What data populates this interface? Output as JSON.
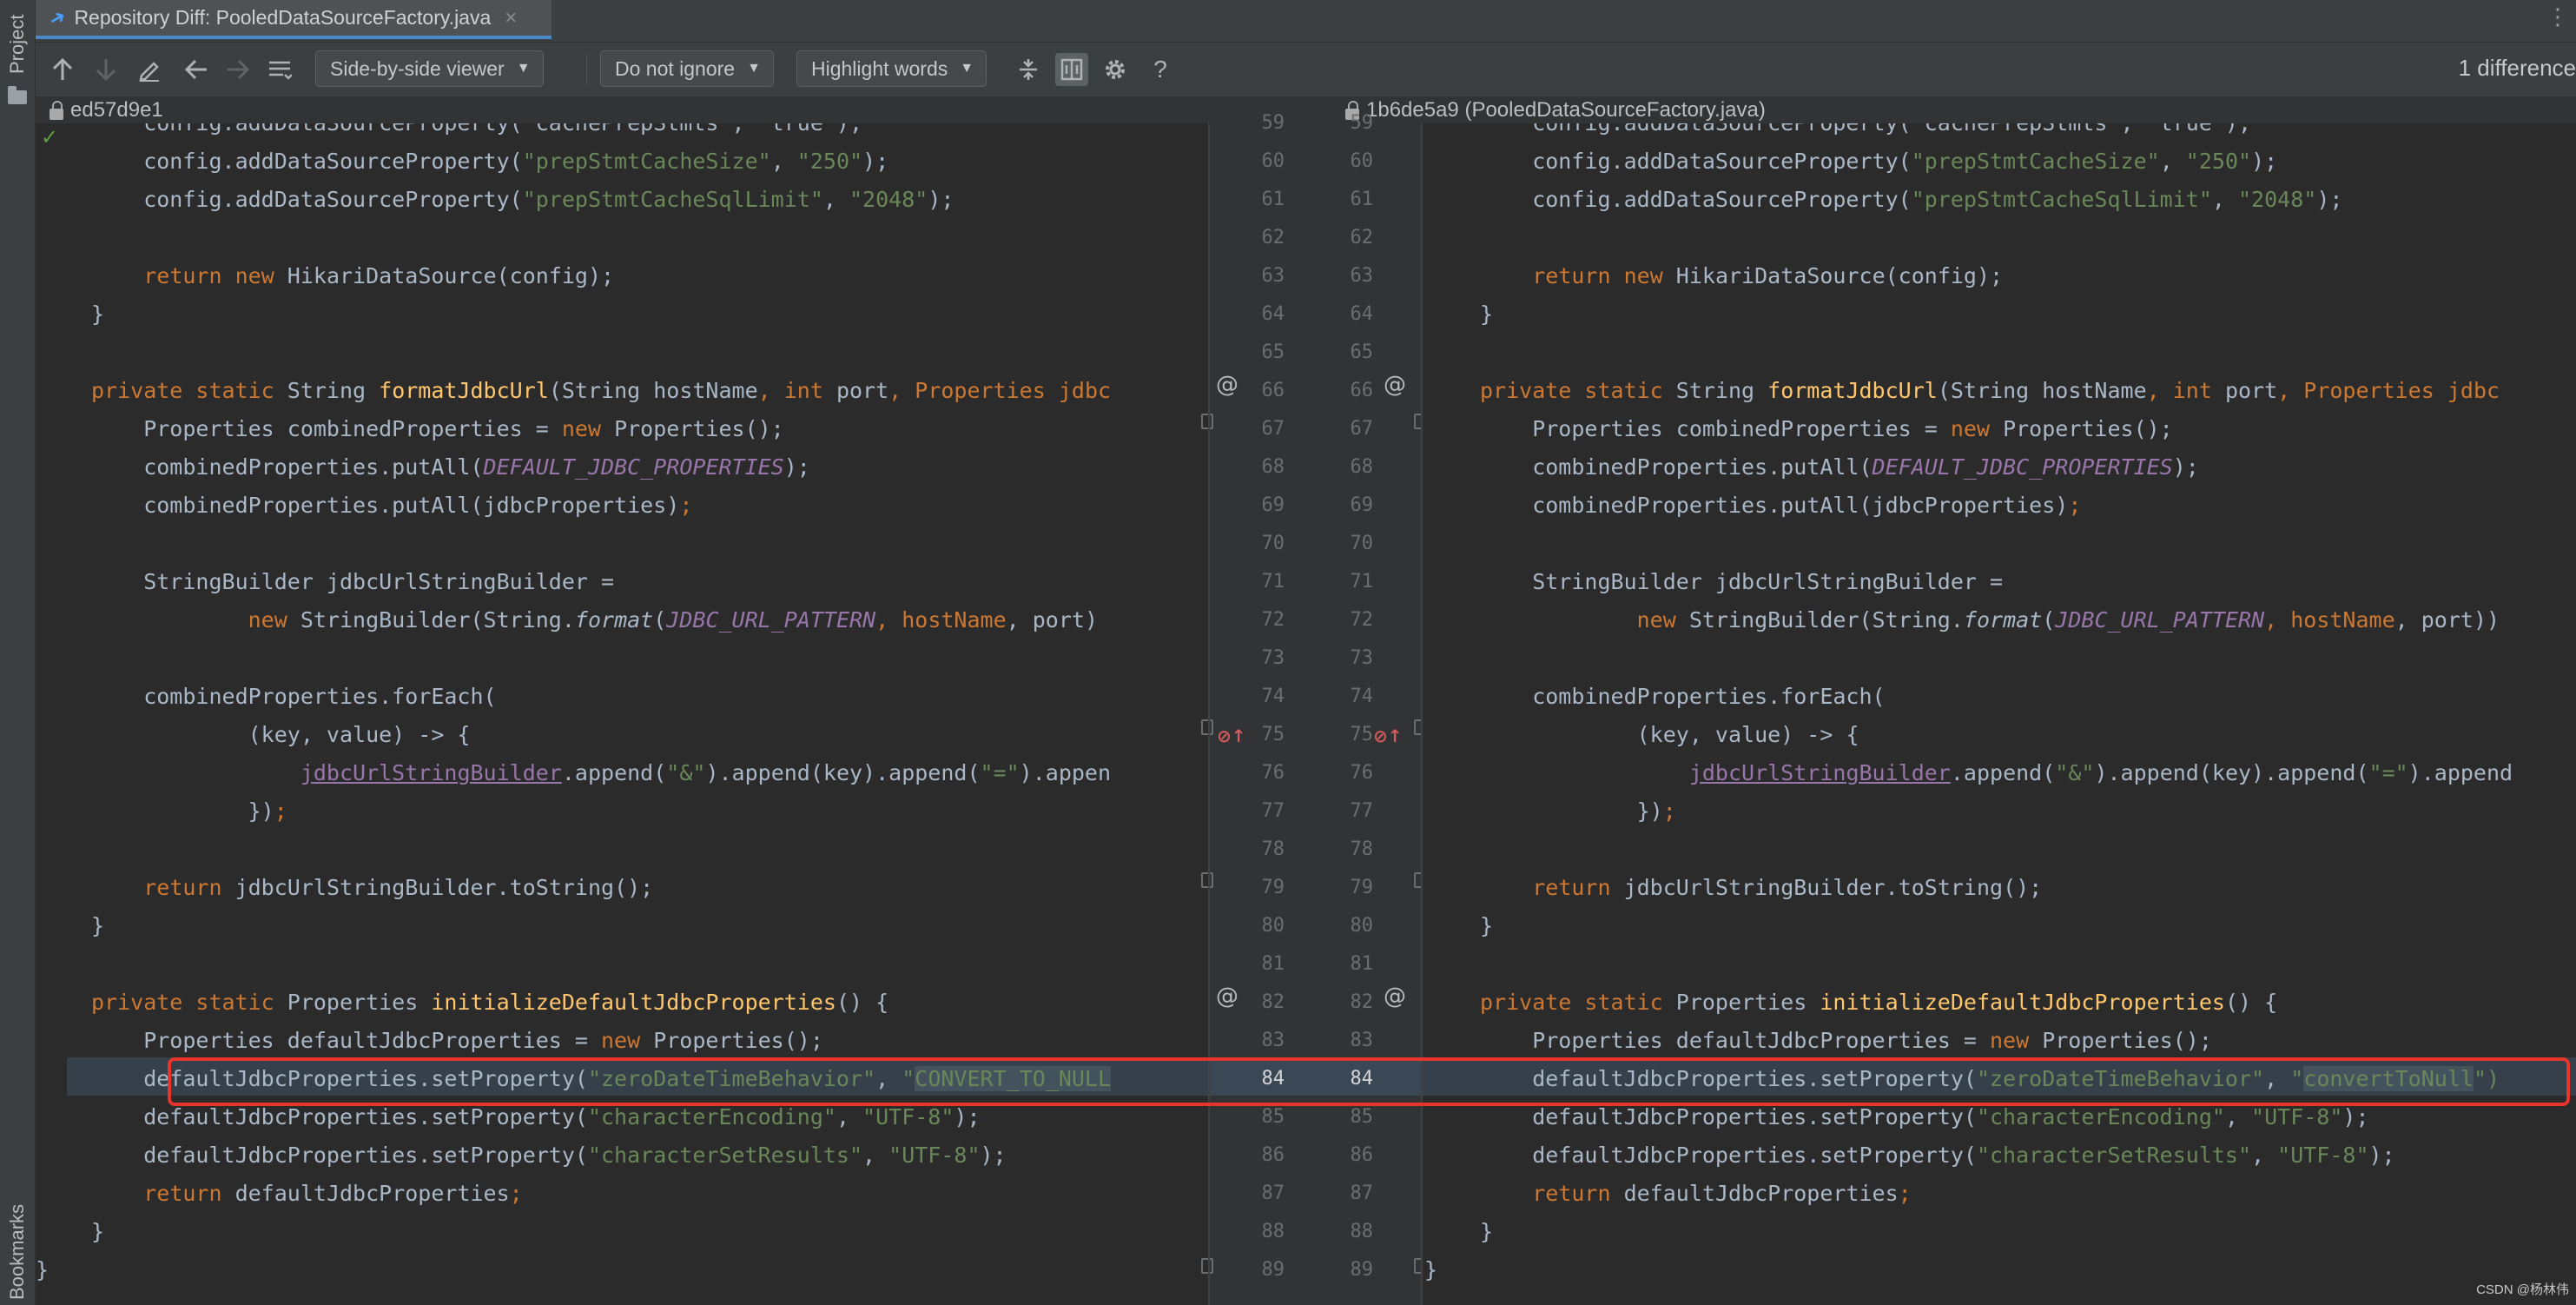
{
  "side_strip": {
    "project_label": "Project",
    "bookmarks_label": "Bookmarks"
  },
  "tab": {
    "title": "Repository Diff: PooledDataSourceFactory.java",
    "close": "×",
    "more": "⋮"
  },
  "toolbar": {
    "viewer_mode": "Side-by-side viewer",
    "ignore_mode": "Do not ignore",
    "highlight_mode": "Highlight words",
    "help": "?",
    "difference_count": "1 difference"
  },
  "left_revision": "ed57d9e1",
  "right_revision": "1b6de5a9 (PooledDataSourceFactory.java)",
  "line_numbers": {
    "first_partial": "59",
    "lines": [
      "60",
      "61",
      "62",
      "63",
      "64",
      "65",
      "66",
      "67",
      "68",
      "69",
      "70",
      "71",
      "72",
      "73",
      "74",
      "75",
      "76",
      "77",
      "78",
      "79",
      "80",
      "81",
      "82",
      "83",
      "84",
      "85",
      "86",
      "87",
      "88",
      "89"
    ],
    "changed_line": "84"
  },
  "left_code": {
    "line59": "    config.addDataSourceProperty(\"cachePrepStmts\", \"true\");",
    "line60_a": "    config.addDataSourceProperty(",
    "line60_s1": "\"prepStmtCacheSize\"",
    "line60_b": ", ",
    "line60_s2": "\"250\"",
    "line60_c": ");",
    "line61_a": "    config.addDataSourceProperty(",
    "line61_s1": "\"prepStmtCacheSqlLimit\"",
    "line61_b": ", ",
    "line61_s2": "\"2048\"",
    "line61_c": ");",
    "line63_a": "    ",
    "line63_kw1": "return",
    "line63_sp": " ",
    "line63_kw2": "new",
    "line63_b": " HikariDataSource(config);",
    "line64": "}",
    "line66_kw": "private static",
    "line66_a": " String ",
    "line66_fn": "formatJdbcUrl",
    "line66_b": "(String hostName",
    "line66_c": ", ",
    "line66_kw2": "int",
    "line66_d": " port",
    "line66_e": ", Properties jdbc",
    "line67_a": "    Properties combinedProperties = ",
    "line67_kw": "new",
    "line67_b": " Properties();",
    "line68_a": "    combinedProperties.putAll(",
    "line68_const": "DEFAULT_JDBC_PROPERTIES",
    "line68_b": ");",
    "line69_a": "    combinedProperties.putAll(jdbcProperties)",
    "line69_b": ";",
    "line71": "    StringBuilder jdbcUrlStringBuilder =",
    "line72_a": "            ",
    "line72_kw": "new",
    "line72_b": " StringBuilder(String.",
    "line72_static": "format",
    "line72_c": "(",
    "line72_const": "JDBC_URL_PATTERN",
    "line72_d": ", hostName",
    "line72_e": ", port)",
    "line74": "    combinedProperties.forEach(",
    "line75_a": "            (key",
    "line75_b": ", value) -> {",
    "line76_a": "                ",
    "line76_field": "jdbcUrlStringBuilder",
    "line76_b": ".append(",
    "line76_s1": "\"&\"",
    "line76_c": ").append(key).append(",
    "line76_s2": "\"=\"",
    "line76_d": ").appen",
    "line77_a": "            })",
    "line77_b": ";",
    "line79_a": "    ",
    "line79_kw": "return",
    "line79_b": " jdbcUrlStringBuilder.toString();",
    "line80": "}",
    "line82_kw": "private static",
    "line82_a": " Properties ",
    "line82_fn": "initializeDefaultJdbcProperties",
    "line82_b": "() {",
    "line83_a": "    Properties defaultJdbcProperties = ",
    "line83_kw": "new",
    "line83_b": " Properties();",
    "line84_a": "    defaultJdbcProperties.setProperty(",
    "line84_s1": "\"zeroDateTimeBehavior\"",
    "line84_b": ", ",
    "line84_s2a": "\"",
    "line84_diff": "CONVERT_TO_NULL",
    "line85_a": "    defaultJdbcProperties.setProperty(",
    "line85_s1": "\"characterEncoding\"",
    "line85_b": ", ",
    "line85_s2": "\"UTF-8\"",
    "line85_c": ");",
    "line86_a": "    defaultJdbcProperties.setProperty(",
    "line86_s1": "\"characterSetResults\"",
    "line86_b": ", ",
    "line86_s2": "\"UTF-8\"",
    "line86_c": ");",
    "line87_a": "    ",
    "line87_kw": "return",
    "line87_b": " defaultJdbcProperties",
    "line87_c": ";",
    "line88": "}",
    "line89": "}"
  },
  "right_code": {
    "line59": "    config.addDataSourceProperty(\"cachePrepStmts\", \"true\");",
    "line72_e": ", port))",
    "line75_a": "            (key",
    "line75_b": ", value) -> {",
    "line76_d": ").append",
    "line84_diff": "convertToNull",
    "line84_end": "\")"
  },
  "watermark": "CSDN @杨林伟"
}
